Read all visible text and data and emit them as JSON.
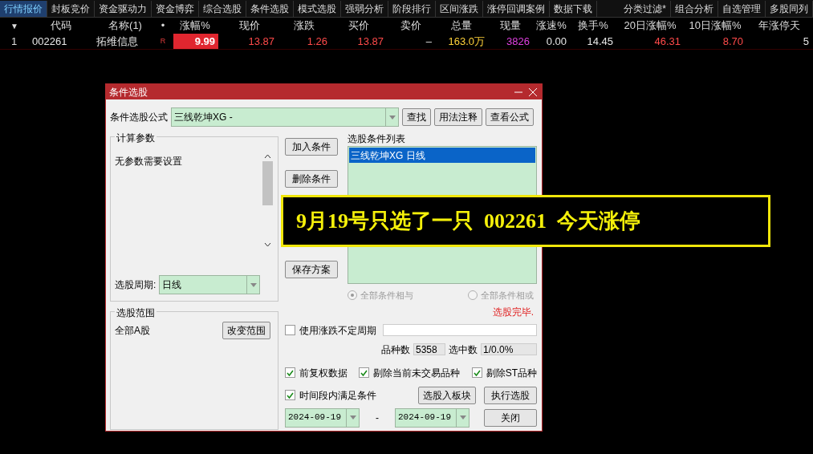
{
  "top_tabs": [
    {
      "label": "行情报价",
      "selected": true
    },
    {
      "label": "封板竞价",
      "selected": false
    },
    {
      "label": "资金驱动力",
      "selected": false
    },
    {
      "label": "资金博弈",
      "selected": false
    },
    {
      "label": "综合选股",
      "selected": false
    },
    {
      "label": "条件选股",
      "selected": false
    },
    {
      "label": "模式选股",
      "selected": false
    },
    {
      "label": "强弱分析",
      "selected": false
    },
    {
      "label": "阶段排行",
      "selected": false
    },
    {
      "label": "区间涨跌",
      "selected": false
    },
    {
      "label": "涨停回调案例",
      "selected": false
    },
    {
      "label": "数据下载",
      "selected": false
    }
  ],
  "right_tabs": [
    {
      "label": "分类过滤*",
      "selected": false
    },
    {
      "label": "组合分析",
      "selected": false
    },
    {
      "label": "自选管理",
      "selected": false
    },
    {
      "label": "多股同列",
      "selected": false
    }
  ],
  "table": {
    "sort_glyph": "▼",
    "columns": [
      "代码",
      "名称(1)",
      "•",
      "涨幅%",
      "现价",
      "涨跌",
      "买价",
      "卖价",
      "总量",
      "现量",
      "涨速%",
      "换手%",
      "20日涨幅%",
      "10日涨幅%",
      "年涨停天"
    ],
    "rows": [
      {
        "index": "1",
        "cells": [
          {
            "text": "002261",
            "kind": "plain"
          },
          {
            "text": "拓维信息",
            "kind": "plain"
          },
          {
            "text": "R",
            "kind": "marker"
          },
          {
            "text": "9.99",
            "kind": "boxed"
          },
          {
            "text": "13.87",
            "kind": "rise"
          },
          {
            "text": "1.26",
            "kind": "rise"
          },
          {
            "text": "13.87",
            "kind": "rise"
          },
          {
            "text": "–",
            "kind": "plain"
          },
          {
            "text": "163.0万",
            "kind": "volume"
          },
          {
            "text": "3826",
            "kind": "current"
          },
          {
            "text": "0.00",
            "kind": "plain"
          },
          {
            "text": "14.45",
            "kind": "plain"
          },
          {
            "text": "46.31",
            "kind": "rise"
          },
          {
            "text": "8.70",
            "kind": "rise"
          },
          {
            "text": "5",
            "kind": "plain"
          }
        ]
      }
    ]
  },
  "dialog": {
    "title": "条件选股",
    "formula_label": "条件选股公式",
    "formula_value": "三线乾坤XG  -",
    "formula_buttons": [
      "查找",
      "用法注释",
      "查看公式"
    ],
    "params_group": {
      "title": "计算参数",
      "text": "无参数需要设置"
    },
    "period": {
      "label": "选股周期:",
      "value": "日线"
    },
    "range_group": {
      "title": "选股范围",
      "text": "全部A股",
      "button": "改变范围"
    },
    "side_buttons": [
      "加入条件",
      "删除条件",
      "保存方案"
    ],
    "condition_list": {
      "title": "选股条件列表",
      "items": [
        {
          "label": "三线乾坤XG  日线",
          "selected": true
        }
      ]
    },
    "logic_radios": [
      {
        "label": "全部条件相与",
        "selected": true,
        "disabled": true
      },
      {
        "label": "全部条件相或",
        "selected": false,
        "disabled": true
      }
    ],
    "status": "选股完毕.",
    "variable_period": {
      "label": "使用涨跌不定周期",
      "checked": false
    },
    "counts": [
      {
        "label": "品种数",
        "value": "5358"
      },
      {
        "label": "选中数",
        "value": "1/0.0%"
      }
    ],
    "options": [
      {
        "label": "前复权数据",
        "checked": true
      },
      {
        "label": "剔除当前未交易品种",
        "checked": true
      },
      {
        "label": "剔除ST品种",
        "checked": true
      }
    ],
    "time_condition": {
      "label": "时间段内满足条件",
      "checked": true
    },
    "to_block_button": "选股入板块",
    "run_button": "执行选股",
    "date_from": "2024-09-19",
    "date_separator": "-",
    "date_to": "2024-09-19",
    "close_button": "关闭"
  },
  "caption": "9月19号只选了一只  002261  今天涨停"
}
